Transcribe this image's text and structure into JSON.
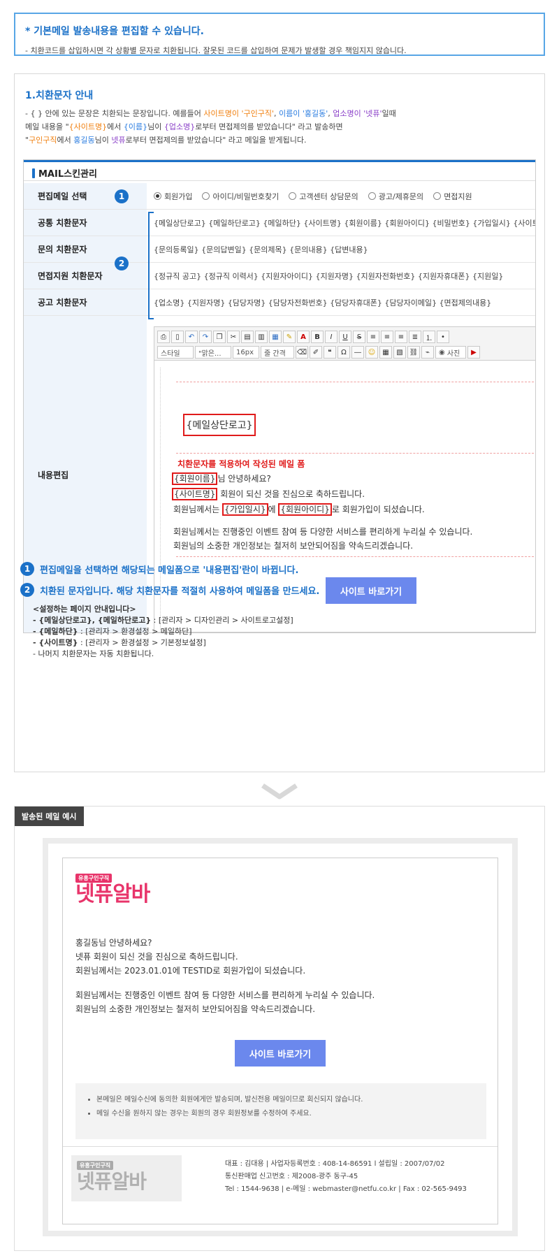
{
  "notice": {
    "title": "* 기본메일 발송내용을 편집할 수 있습니다.",
    "desc": "- 치환코드를 삽입하시면 각 상황별 문자로 치환됩니다. 잘못된 코드를 삽입하여 문제가 발생할 경우 책임지지 않습니다."
  },
  "guide": {
    "title": "1.치환문자 안내",
    "l1a": "- { } 안에 있는 문장은 치환되는 문장입니다. 예를들어 ",
    "l1b": "사이트명이 '구인구직'",
    "l1c": ", ",
    "l1d": "이름이 '홍길동'",
    "l1e": ", ",
    "l1f": "업소명이 '넷퓨'",
    "l1g": "일때",
    "l2a": "  메일 내용을 \"",
    "l2b": "{사이트명}",
    "l2c": "에서 ",
    "l2d": "{이름}",
    "l2e": "님이 ",
    "l2f": "{업소명}",
    "l2g": "로부터 면접제의를 받았습니다\" 라고 발송하면",
    "l3a": "  \"",
    "l3b": "구인구직",
    "l3c": "에서 ",
    "l3d": "홍길동",
    "l3e": "님이 ",
    "l3f": "넷퓨",
    "l3g": "로부터 면접제의를 받았습니다\" 라고 메일을 받게됩니다."
  },
  "skin": {
    "header": "MAIL스킨관리",
    "rows": {
      "select_label": "편집메일 선택",
      "common_label": "공통 치환문자",
      "common_codes": "{메일상단로고} {메일하단로고} {메일하단} {사이트명} {회원이름} {회원아이디} {비밀번호} {가입일시} {사이트주소}",
      "inquiry_label": "문의 치환문자",
      "inquiry_codes": "{문의등록일} {문의답변일} {문의제목} {문의내용} {답변내용}",
      "interview_label": "면접지원 치환문자",
      "interview_codes": "{정규직 공고} {정규직 이력서} {지원자아이디} {지원자명} {지원자전화번호} {지원자휴대폰} {지원일}",
      "ad_label": "공고 치환문자",
      "ad_codes": "{업소명} {지원자명} {담당자명} {담당자전화번호} {담당자휴대폰} {담당자이메일} {면접제의내용}",
      "edit_label": "내용편집"
    },
    "radios": [
      "회원가입",
      "아이디/비밀번호찾기",
      "고객센터 상담문의",
      "광고/제휴문의",
      "면접지원"
    ],
    "num1": "1",
    "num2": "2"
  },
  "editor": {
    "style_sel": "스타일",
    "font_sel": "\"맑은...",
    "size_sel": "16px",
    "line_sel": "줄 간격",
    "photo_btn": "사진",
    "logo_code": "{메일상단로고}",
    "form_title": "치환문자를 적용하여 작성된 메일 폼",
    "line1_code": "{회원이름}",
    "line1_rest": "님 안녕하세요?",
    "line2_code": "{사이트명}",
    "line2_rest": " 회원이 되신 것을 진심으로 축하드립니다.",
    "line3_a": "회원님께서는 ",
    "line3_code1": "{가입일시}",
    "line3_b": "에 ",
    "line3_code2": "{회원아이디}",
    "line3_c": "로 회원가입이 되셨습니다.",
    "line4": "회원님께서는 진행중인 이벤트 참여 등 다양한 서비스를 편리하게 누리실 수 있습니다.",
    "line5": "회원님의 소중한 개인정보는 철저히 보안되어짐을 약속드리겠습니다.",
    "site_button": "사이트 바로가기"
  },
  "notes": {
    "n1": "1",
    "n1_text": "편집메일을 선택하면 해당되는 메일폼으로 '내용편집'란이 바뀝니다.",
    "n2": "2",
    "n2_text": "치환된 문자입니다. 해당 치환문자를 적절히 사용하여 메일폼을 만드세요.",
    "s_title": "<설정하는 페이지 안내입니다>",
    "s1_code": "- {메일상단로고}, {메일하단로고}",
    "s1_path": " : [관리자 > 디자인관리 > 사이트로고설정]",
    "s2_code": "- {메일하단}",
    "s2_path": " : [관리자 > 환경설정 > 메일하단]",
    "s3_code": "- {사이트명}",
    "s3_path": " : [관리자 > 환경설정 > 기본정보설정]",
    "s4": "- 나머지 치환문자는 자동 치환됩니다."
  },
  "example": {
    "tag": "발송된 메일 예시",
    "logo_small": "유흥구인구직",
    "logo_main": "넷퓨알바",
    "l1": "홍길동님 안녕하세요?",
    "l2": "넷퓨 회원이 되신 것을 진심으로 축하드립니다.",
    "l3": "회원님께서는 2023.01.01에 TESTID로 회원가입이 되셨습니다.",
    "l4": "회원님께서는 진행중인 이벤트 참여 등 다양한 서비스를 편리하게 누리실 수 있습니다.",
    "l5": "회원님의 소중한 개인정보는 철저히 보안되어짐을 약속드리겠습니다.",
    "site_button": "사이트 바로가기",
    "note1": "본메일은 메일수신에 동의한 회원에게만 발송되며, 발신전용 메일이므로 회신되지 않습니다.",
    "note2": "메일 수신을 원하지 않는 경우는 회원의 경우 회원정보를 수정하여 주세요.",
    "f1": "대표 : 김대용 | 사업자등록번호 : 408-14-86591 l 설립일 : 2007/07/02",
    "f2": "통신판매업 신고번호 : 제2008-광주 동구-45",
    "f3": "Tel : 1544-9638 | e-메일 : webmaster@netfu.co.kr | Fax : 02-565-9493"
  },
  "colors": {
    "accent": "#1b71c8",
    "button": "#6b88ed",
    "highlight": "#e01b1b",
    "logo": "#e8346a"
  }
}
